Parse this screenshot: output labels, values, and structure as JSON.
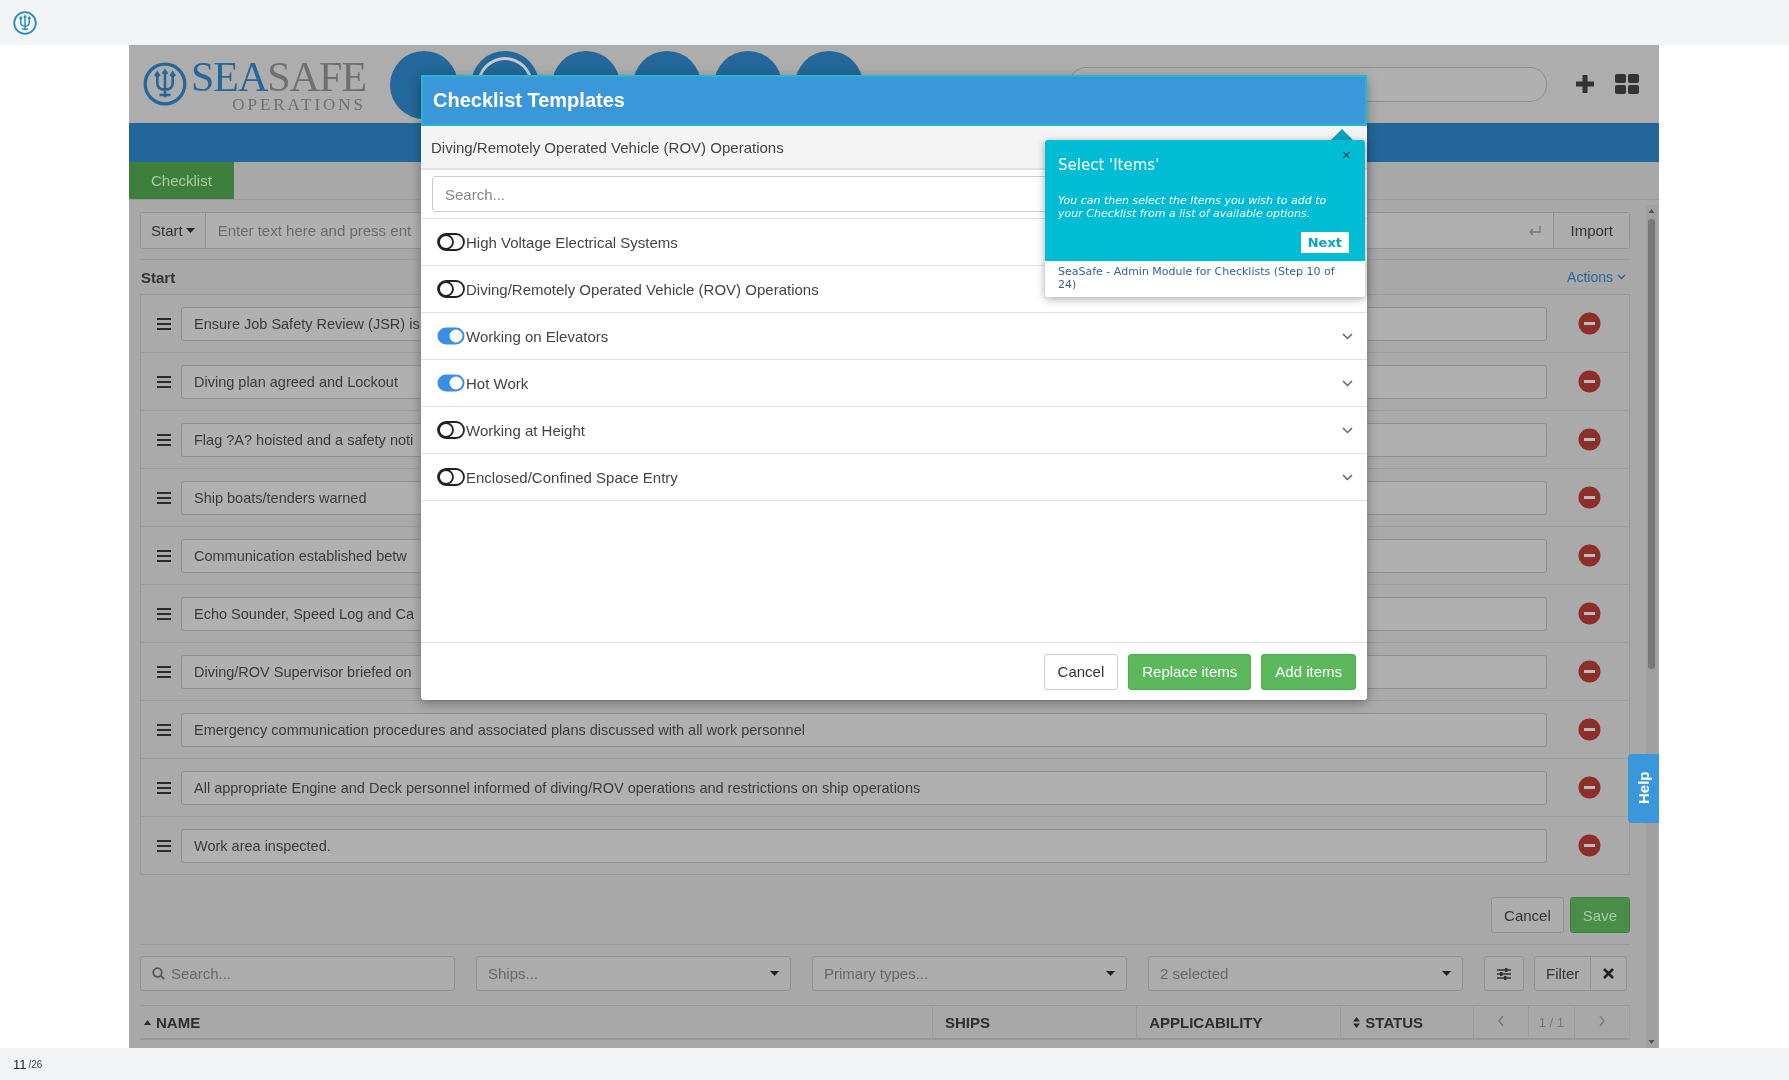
{
  "viewer": {
    "page": "11",
    "total": "/26"
  },
  "header": {
    "logo_a": "SEA",
    "logo_b": "SAFE",
    "logo_sub": "OPERATIONS",
    "nav_count_ring": [
      false,
      true,
      false,
      false,
      false,
      false
    ]
  },
  "tabs": [
    {
      "label": "Checklist",
      "selected": true
    }
  ],
  "entry": {
    "mode": "Start",
    "placeholder": "Enter text here and press ent",
    "import": "Import"
  },
  "section": {
    "title": "Start",
    "actions": "Actions"
  },
  "items": [
    {
      "text": "Ensure Job Safety Review (JSR) is"
    },
    {
      "text": "Diving plan agreed and Lockout"
    },
    {
      "text": "Flag ?A? hoisted and a safety noti"
    },
    {
      "text": "Ship boats/tenders warned"
    },
    {
      "text": "Communication established betw"
    },
    {
      "text": "Echo Sounder, Speed Log and Ca"
    },
    {
      "text": "Diving/ROV Supervisor briefed on"
    },
    {
      "text": "Emergency communication procedures and associated plans discussed with all work personnel"
    },
    {
      "text": "All appropriate Engine and Deck personnel informed of diving/ROV operations and restrictions on ship operations"
    },
    {
      "text": "Work area inspected."
    }
  ],
  "form_buttons": [
    {
      "label": "Cancel",
      "kind": "default"
    },
    {
      "label": "Save",
      "kind": "primary"
    }
  ],
  "filters": {
    "search": "Search...",
    "ships": "Ships...",
    "primary_types": "Primary types...",
    "applicability": "2 selected",
    "filter": "Filter"
  },
  "table": {
    "columns": [
      {
        "label": "NAME",
        "sortable": true,
        "ascending": true
      },
      {
        "label": "SHIPS",
        "sortable": false
      },
      {
        "label": "APPLICABILITY",
        "sortable": false
      },
      {
        "label": "STATUS",
        "sortable": true,
        "ascending": false
      }
    ],
    "pager": "1 / 1"
  },
  "help": "Help",
  "modal": {
    "title": "Checklist Templates",
    "subtitle": "Diving/Remotely Operated Vehicle (ROV) Operations",
    "search_placeholder": "Search...",
    "templates": [
      {
        "label": "High Voltage Electrical Systems",
        "on": false,
        "expandable": false
      },
      {
        "label": "Diving/Remotely Operated Vehicle (ROV) Operations",
        "on": false,
        "expandable": false
      },
      {
        "label": "Working on Elevators",
        "on": true,
        "expandable": true
      },
      {
        "label": "Hot Work",
        "on": true,
        "expandable": true
      },
      {
        "label": "Working at Height",
        "on": false,
        "expandable": true
      },
      {
        "label": "Enclosed/Confined Space Entry",
        "on": false,
        "expandable": true
      }
    ],
    "buttons": [
      {
        "label": "Cancel",
        "kind": "default"
      },
      {
        "label": "Replace items",
        "kind": "primary"
      },
      {
        "label": "Add items",
        "kind": "primary"
      }
    ]
  },
  "tour": {
    "title": "Select 'Items'",
    "body": "You can then select the Items you wish to add to your Checklist from a list of available options.",
    "next": "Next",
    "close": "×",
    "footer": "SeaSafe - Admin Module for Checklists (Step 10 of 24)"
  }
}
